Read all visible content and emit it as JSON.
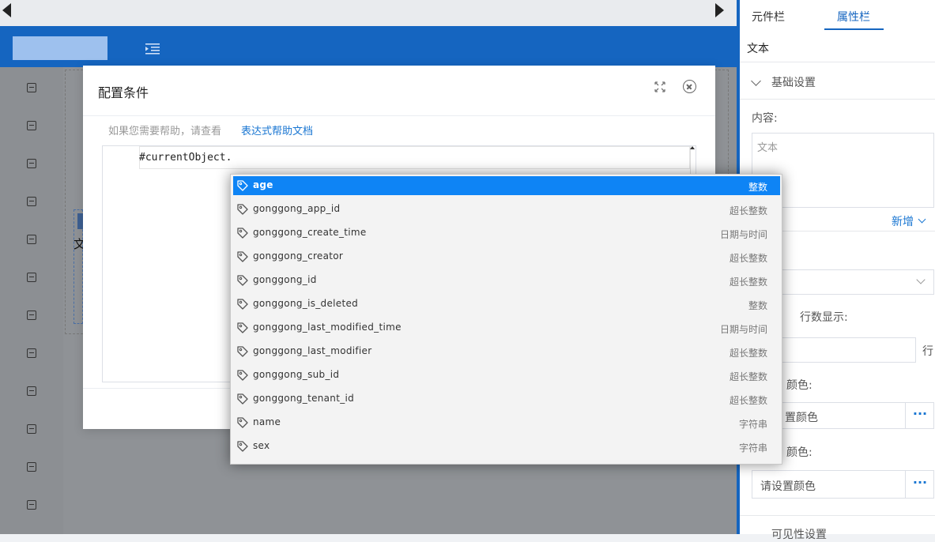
{
  "right_panel": {
    "tabs": [
      "元件栏",
      "属性栏"
    ],
    "active_tab": "属性栏",
    "title": "文本",
    "basic_section": "基础设置",
    "content_label": "内容:",
    "content_placeholder": "文本",
    "add_label": "新增",
    "rows_label": "行数显示:",
    "rows_unit": "行",
    "color1_label": "颜色:",
    "color1_text": "置颜色",
    "color2_label": "颜色:",
    "color2_text": "请设置颜色",
    "more_btn": "···",
    "visibility_section": "可见性设置"
  },
  "canvas": {
    "text_fragment": "文"
  },
  "modal": {
    "title": "配置条件",
    "help_prefix": "如果您需要帮助，请查看",
    "help_link": "表达式帮助文档",
    "code": "#currentObject."
  },
  "suggestions": [
    {
      "name": "age",
      "type": "整数",
      "selected": true
    },
    {
      "name": "gonggong_app_id",
      "type": "超长整数"
    },
    {
      "name": "gonggong_create_time",
      "type": "日期与时间"
    },
    {
      "name": "gonggong_creator",
      "type": "超长整数"
    },
    {
      "name": "gonggong_id",
      "type": "超长整数"
    },
    {
      "name": "gonggong_is_deleted",
      "type": "整数"
    },
    {
      "name": "gonggong_last_modified_time",
      "type": "日期与时间"
    },
    {
      "name": "gonggong_last_modifier",
      "type": "超长整数"
    },
    {
      "name": "gonggong_sub_id",
      "type": "超长整数"
    },
    {
      "name": "gonggong_tenant_id",
      "type": "超长整数"
    },
    {
      "name": "name",
      "type": "字符串"
    },
    {
      "name": "sex",
      "type": "字符串"
    }
  ],
  "colors": {
    "primary": "#1565c0",
    "selection": "#0e84f5",
    "link": "#1976d2"
  },
  "icons": {
    "nav_prev": "triangle-left-icon",
    "nav_next": "triangle-right-icon",
    "menu": "indent-menu-icon",
    "fullscreen": "fullscreen-icon",
    "close": "close-circle-icon",
    "field": "tag-icon"
  }
}
